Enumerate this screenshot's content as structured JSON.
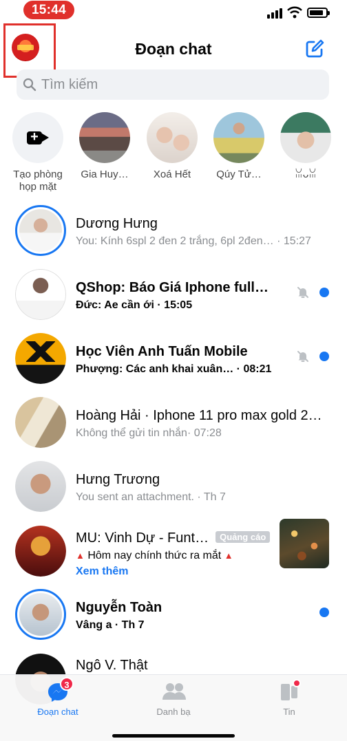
{
  "status_bar": {
    "time": "15:44"
  },
  "header": {
    "title": "Đoạn chat"
  },
  "search": {
    "placeholder": "Tìm kiếm"
  },
  "stories": [
    {
      "label": "Tạo phòng họp mặt"
    },
    {
      "label": "Gia Huy…"
    },
    {
      "label": "Xoá Hết"
    },
    {
      "label": "Qúy Tử…"
    },
    {
      "label": "ꈍᴗꈍ"
    }
  ],
  "chats": [
    {
      "name": "Dương Hưng",
      "preview": "You: Kính 6spl 2 đen 2 trắng, 6pl 2đen… · 15:27",
      "unread": false,
      "muted": false
    },
    {
      "name": "QShop: Báo Giá Iphone full…",
      "preview": "Đức: Ae cần ới · 15:05",
      "unread": true,
      "muted": true
    },
    {
      "name": "Học Viên Anh Tuấn Mobile",
      "preview": "Phượng: Các anh khai xuân… · 08:21",
      "unread": true,
      "muted": true
    },
    {
      "name": "Hoàng Hải · Iphone 11 pro max gold 2…",
      "preview": "Không thể gửi tin nhắn· 07:28",
      "unread": false,
      "muted": false
    },
    {
      "name": "Hưng Trương",
      "preview": "You sent an attachment. · Th 7",
      "unread": false,
      "muted": false
    },
    {
      "name": "Nguyễn Toàn",
      "preview": "Vâng a · Th 7",
      "unread": true,
      "muted": false
    },
    {
      "name": "Ngô V. Thật",
      "preview": "",
      "unread": false,
      "muted": false
    }
  ],
  "ad": {
    "name": "MU: Vinh Dự - Funt…",
    "badge": "Quảng cáo",
    "text": "Hôm nay chính thức ra mắt",
    "more": "Xem thêm"
  },
  "tabs": [
    {
      "label": "Đoạn chat",
      "badge": "3"
    },
    {
      "label": "Danh bạ"
    },
    {
      "label": "Tin"
    }
  ],
  "colors": {
    "accent": "#1877f2",
    "highlight": "#e0302b",
    "badge": "#f02849"
  }
}
